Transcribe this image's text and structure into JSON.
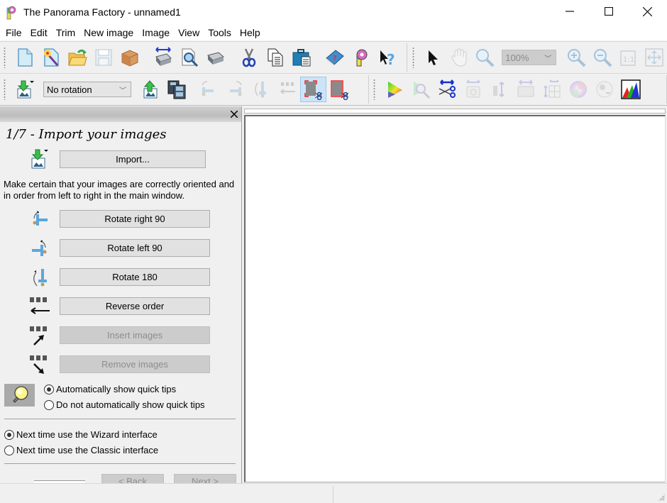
{
  "window": {
    "title": "The Panorama Factory - unnamed1",
    "controls": {
      "minimize": "—",
      "maximize": "☐",
      "close": "✕"
    }
  },
  "menubar": {
    "items": [
      {
        "label": "File"
      },
      {
        "label": "Edit"
      },
      {
        "label": "Trim"
      },
      {
        "label": "New image"
      },
      {
        "label": "Image"
      },
      {
        "label": "View"
      },
      {
        "label": "Tools"
      },
      {
        "label": "Help"
      }
    ]
  },
  "toolbar_main": {
    "buttons": [
      {
        "name": "new-document",
        "tooltip": "New",
        "enabled": true
      },
      {
        "name": "wizard",
        "tooltip": "Wizard",
        "enabled": true
      },
      {
        "name": "open",
        "tooltip": "Open",
        "enabled": true
      },
      {
        "name": "save",
        "tooltip": "Save",
        "enabled": false
      },
      {
        "name": "package",
        "tooltip": "Package",
        "enabled": true
      },
      {
        "name": "print-wide",
        "tooltip": "Print wide",
        "enabled": true
      },
      {
        "name": "print-preview",
        "tooltip": "Print preview",
        "enabled": true
      },
      {
        "name": "print",
        "tooltip": "Print",
        "enabled": true
      },
      {
        "name": "cut",
        "tooltip": "Cut",
        "enabled": true
      },
      {
        "name": "copy",
        "tooltip": "Copy",
        "enabled": true
      },
      {
        "name": "paste",
        "tooltip": "Paste",
        "enabled": true
      },
      {
        "name": "help-book",
        "tooltip": "Help",
        "enabled": true
      },
      {
        "name": "about",
        "tooltip": "About",
        "enabled": true
      },
      {
        "name": "context-help",
        "tooltip": "What's this?",
        "enabled": true
      }
    ]
  },
  "toolbar_view": {
    "zoom_value": "100%",
    "buttons": [
      {
        "name": "select-pointer",
        "enabled": true
      },
      {
        "name": "pan-hand",
        "enabled": false
      },
      {
        "name": "zoom-tool",
        "enabled": false
      },
      {
        "name": "zoom-in",
        "enabled": false
      },
      {
        "name": "zoom-out",
        "enabled": false
      },
      {
        "name": "actual-size",
        "label": "1:1",
        "enabled": false
      },
      {
        "name": "fit-window",
        "enabled": false
      }
    ]
  },
  "toolbar_images": {
    "rotation_select": "No rotation",
    "buttons": [
      {
        "name": "import",
        "enabled": true
      },
      {
        "name": "export",
        "enabled": true
      },
      {
        "name": "filmstrip",
        "enabled": true
      },
      {
        "name": "rotate-right",
        "enabled": false
      },
      {
        "name": "rotate-left",
        "enabled": false
      },
      {
        "name": "rotate-180",
        "enabled": false
      },
      {
        "name": "reverse-order",
        "enabled": false
      },
      {
        "name": "crop-trim",
        "enabled": true,
        "active": true
      },
      {
        "name": "crop-trim-alt",
        "enabled": true
      }
    ]
  },
  "toolbar_process": {
    "buttons": [
      {
        "name": "color-gamut",
        "enabled": true
      },
      {
        "name": "color-inspect",
        "enabled": false
      },
      {
        "name": "stitch-cut",
        "enabled": true
      },
      {
        "name": "horizontal-align",
        "enabled": false
      },
      {
        "name": "vertical-shift",
        "enabled": false
      },
      {
        "name": "horizontal-stretch",
        "enabled": false
      },
      {
        "name": "grid-adjust",
        "enabled": false
      },
      {
        "name": "color-wheel",
        "enabled": false
      },
      {
        "name": "lens-correction",
        "enabled": false
      },
      {
        "name": "histogram",
        "enabled": true
      }
    ]
  },
  "wizard": {
    "step_title": "1/7 - Import your images",
    "import_button": "Import...",
    "instructions": "Make certain that your images are correctly oriented and in order from left to right in the main window.",
    "actions": [
      {
        "label": "Rotate right 90",
        "icon": "rotate-right-icon",
        "enabled": true
      },
      {
        "label": "Rotate left 90",
        "icon": "rotate-left-icon",
        "enabled": true
      },
      {
        "label": "Rotate 180",
        "icon": "rotate-180-icon",
        "enabled": true
      },
      {
        "label": "Reverse order",
        "icon": "reverse-order-icon",
        "enabled": true
      },
      {
        "label": "Insert images",
        "icon": "insert-images-icon",
        "enabled": false
      },
      {
        "label": "Remove images",
        "icon": "remove-images-icon",
        "enabled": false
      }
    ],
    "quick_tips": {
      "options": [
        {
          "label": "Automatically show quick tips",
          "checked": true
        },
        {
          "label": "Do not automatically show quick tips",
          "checked": false
        }
      ]
    },
    "interface": {
      "options": [
        {
          "label": "Next time use the Wizard interface",
          "checked": true
        },
        {
          "label": "Next time use the Classic interface",
          "checked": false
        }
      ]
    },
    "nav": {
      "back": "< Back",
      "next": "Next >"
    }
  },
  "statusbar": {
    "left": "",
    "right": ""
  }
}
